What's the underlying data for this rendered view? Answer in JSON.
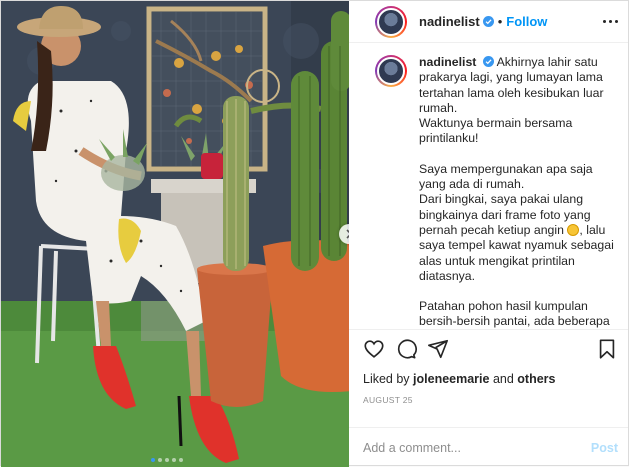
{
  "header": {
    "username": "nadinelist",
    "separator": "•",
    "follow_label": "Follow"
  },
  "caption": {
    "username": "nadinelist",
    "paragraphs": [
      "Akhirnya lahir satu prakarya lagi, yang lumayan lama tertahan lama oleh kesibukan luar rumah.",
      "Waktunya bermain bersama printilanku!",
      "Saya mempergunakan apa saja yang ada di rumah.",
      "Dari bingkai, saya pakai ulang bingkainya dari frame foto yang pernah pecah ketiup angin",
      ", lalu saya tempel kawat nyamuk sebagai alas untuk mengikat printilan diatasnya.",
      "Patahan pohon hasil kumpulan bersih-bersih pantai, ada beberapa yg saya bawa pulang"
    ]
  },
  "likes": {
    "prefix": "Liked by ",
    "user": "joleneemarie",
    "middle": " and ",
    "others": "others"
  },
  "date": "AUGUST 25",
  "comment": {
    "placeholder": "Add a comment...",
    "post_label": "Post"
  },
  "carousel": {
    "count": 5,
    "active_index": 0
  },
  "colors": {
    "follow": "#0095f6",
    "verified": "#3897f0",
    "post_disabled": "#b2dffc"
  },
  "icons": [
    "heart-icon",
    "comment-icon",
    "share-icon",
    "bookmark-icon",
    "verified-badge-icon",
    "more-options-icon",
    "chevron-right-icon"
  ]
}
